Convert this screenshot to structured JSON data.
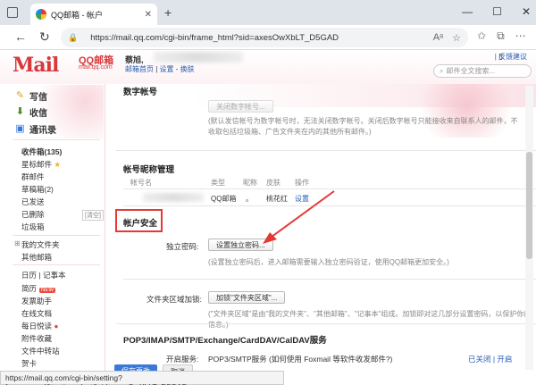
{
  "browser": {
    "tab_title": "QQ邮箱 - 帐户",
    "tab_close": "✕",
    "new_tab": "+",
    "url": "https://mail.qq.com/cgi-bin/frame_html?sid=axesOwXbLT_D5GAD",
    "status_url": "https://mail.qq.com/cgi-bin/setting?fun=secpwd&t=attrpwdset&sid=axesOwXbLT_D5GAD"
  },
  "header": {
    "logo": "Mail",
    "logo_cn": "QQ邮箱",
    "logo_domain": "mail.qq.com",
    "greeting": "蔡旭,",
    "links": [
      "邮箱首页",
      "设置",
      "换肤"
    ],
    "top_right": "| 反馈建议",
    "search_placeholder": "邮件全文搜索..."
  },
  "sidebar": {
    "buttons": [
      "写信",
      "收信",
      "通讯录"
    ],
    "inbox": "收件箱(135)",
    "folders": [
      "星标邮件",
      "群邮件",
      "草稿箱(2)",
      "已发送",
      "已删除",
      "垃圾箱"
    ],
    "empty_label": "[清空]",
    "my_folders": "我的文件夹",
    "other_mail": "其他邮箱",
    "apps": [
      "日历",
      "记事本",
      "简历",
      "发票助手",
      "在线文档",
      "每日悦读",
      "附件收藏",
      "文件中转站",
      "贺卡"
    ],
    "new_badge": "NEW",
    "apps_sep": "|"
  },
  "content": {
    "section_top": "数字帐号",
    "close_digit_btn": "关闭数字帐号...",
    "close_digit_hint": "(默认发信帐号为数字帐号时，无法关闭数字帐号。关闭后数字帐号只能接收来自联系人的邮件，不收取包括垃圾箱、广告文件夹在内的其他所有邮件。)",
    "nickname_title": "帐号昵称管理",
    "table_headers": [
      "帐号名",
      "类型",
      "昵称",
      "皮肤",
      "操作"
    ],
    "table_row": {
      "type": "QQ邮箱",
      "nick": "。",
      "skin": "桃花红",
      "action": "设置"
    },
    "security_title": "帐户安全",
    "pwd_label": "独立密码:",
    "pwd_btn": "设置独立密码...",
    "pwd_hint": "(设置独立密码后，进入邮箱需要输入独立密码验证，使用QQ邮箱更加安全。)",
    "folder_label": "文件夹区域加锁:",
    "folder_btn": "加锁\"文件夹区域\"...",
    "folder_hint": "(\"文件夹区域\"是由\"我的文件夹\"、\"其他邮箱\"、\"记事本\"组成。加锁即对这几部分设置密码，以保护你的信息。)",
    "pop_title": "POP3/IMAP/SMTP/Exchange/CardDAV/CalDAV服务",
    "pop_row_label": "开启服务:",
    "pop_row_text": "POP3/SMTP服务 (如何使用 Foxmail 等软件收发邮件?)",
    "pop_status": "已关闭 | 开启",
    "save_btn": "保存更改",
    "cancel_btn": "取消"
  },
  "colors": {
    "brand_red": "#d7393b",
    "link_blue": "#275bb3",
    "highlight": "#e53935"
  }
}
